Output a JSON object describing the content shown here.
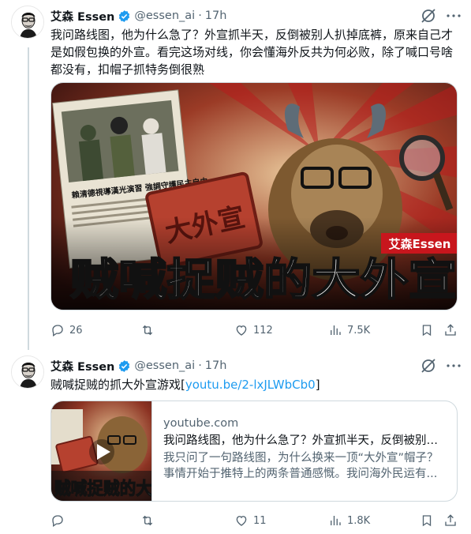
{
  "tweets": [
    {
      "author_name": "艾森 Essen",
      "handle": "@essen_ai",
      "separator": "·",
      "time": "17h",
      "text": "我问路线图，他为什么急了？外宣抓半天，反倒被别人扒掉底裤，原来自己才是如假包换的外宣。看完这场对线，你会懂海外反共为何必败，除了喊口号啥都没有，扣帽子抓特务倒很熟",
      "media": {
        "headline": "贼喊捉贼的大外宣",
        "sign_text": "大外宣",
        "newspaper_headline": "賴清德視導漢光演習 強調守護民主自由",
        "watermark": "艾森Essen"
      },
      "stats": {
        "replies": "26",
        "reposts": "",
        "likes": "112",
        "views": "7.5K"
      }
    },
    {
      "author_name": "艾森 Essen",
      "handle": "@essen_ai",
      "separator": "·",
      "time": "17h",
      "text_prefix": "贼喊捉贼的抓大外宣游戏[",
      "link_text": "youtu.be/2-lxJLWbCb0",
      "text_suffix": "]",
      "card": {
        "domain": "youtube.com",
        "title": "我问路线图，他为什么急了？外宣抓半天，反倒被别人扒掉底裤，原来自己才是如假包换的外宣。看完这场对线，你会懂海外反共为何必败，除了喊口号啥都没有，扣帽子抓特务倒很熟",
        "description": "我只问了一句路线图，为什么换来一顶“大外宣”帽子？事情开始于推特上的两条普通感慨。我问海外民运有...",
        "thumb_text": "贼喊捉贼的大"
      },
      "stats": {
        "replies": "",
        "reposts": "",
        "likes": "11",
        "views": "1.8K"
      }
    }
  ],
  "colors": {
    "text_primary": "#0f1419",
    "text_secondary": "#536471",
    "link": "#1d9bf0",
    "verified": "#1d9bf0",
    "border": "#cfd9de",
    "headline_red": "#c8161d"
  },
  "icons": [
    "verified-badge-icon",
    "grok-icon",
    "more-icon",
    "reply-icon",
    "repost-icon",
    "like-icon",
    "views-icon",
    "bookmark-icon",
    "share-icon",
    "play-icon"
  ]
}
